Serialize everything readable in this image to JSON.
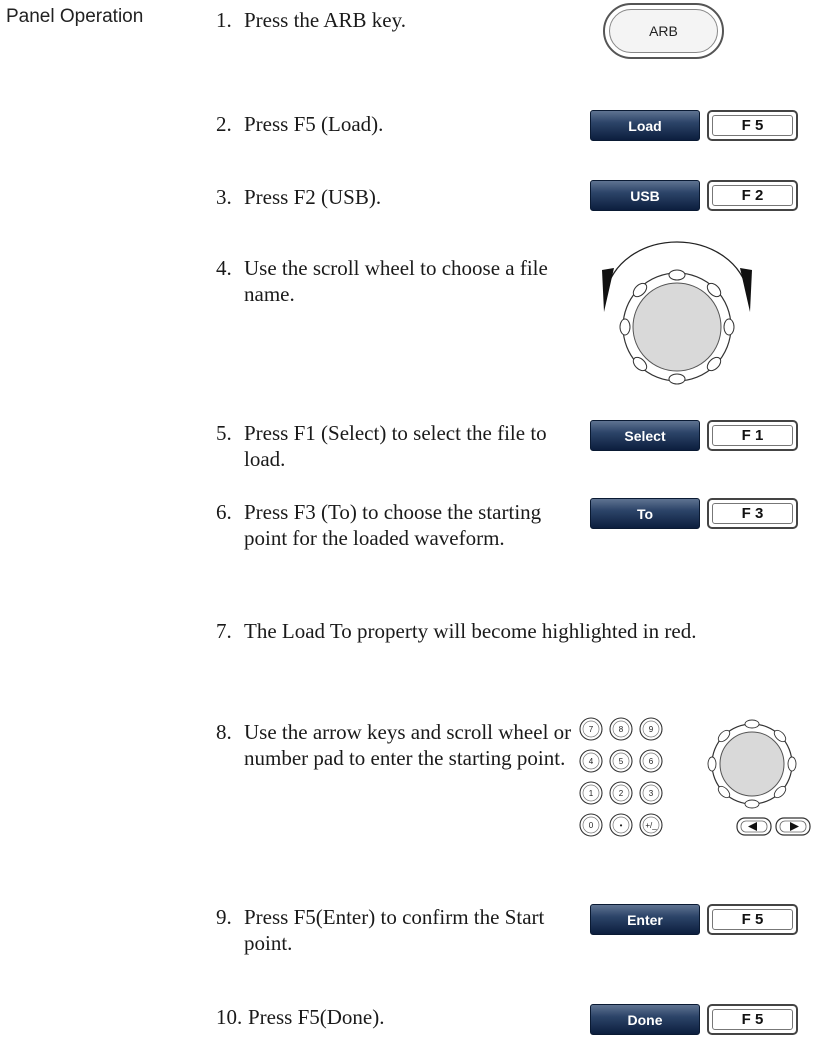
{
  "section_label": "Panel Operation",
  "arb_key_label": "ARB",
  "steps": [
    {
      "num": "1.",
      "text": "Press the ARB key."
    },
    {
      "num": "2.",
      "text": "Press F5 (Load)."
    },
    {
      "num": "3.",
      "text": "Press F2 (USB)."
    },
    {
      "num": "4.",
      "text": "Use the scroll wheel to choose a file name."
    },
    {
      "num": "5.",
      "text": "Press F1 (Select) to select the file to load."
    },
    {
      "num": "6.",
      "text": "Press F3 (To) to choose the starting point for the loaded waveform."
    },
    {
      "num": "7.",
      "text": " The Load To property will become highlighted in red."
    },
    {
      "num": "8.",
      "text": "Use the arrow keys and scroll wheel or number pad to enter the starting point."
    },
    {
      "num": "9.",
      "text": "Press F5(Enter) to confirm the Start point."
    },
    {
      "num": "10.",
      "text": "Press F5(Done)."
    }
  ],
  "buttons": {
    "load": {
      "softkey": "Load",
      "fkey": "F 5"
    },
    "usb": {
      "softkey": "USB",
      "fkey": "F 2"
    },
    "select": {
      "softkey": "Select",
      "fkey": "F 1"
    },
    "to": {
      "softkey": "To",
      "fkey": "F 3"
    },
    "enter": {
      "softkey": "Enter",
      "fkey": "F 5"
    },
    "done": {
      "softkey": "Done",
      "fkey": "F 5"
    }
  },
  "numpad_keys": [
    "7",
    "8",
    "9",
    "4",
    "5",
    "6",
    "1",
    "2",
    "3",
    "0",
    "•",
    "+/_"
  ]
}
